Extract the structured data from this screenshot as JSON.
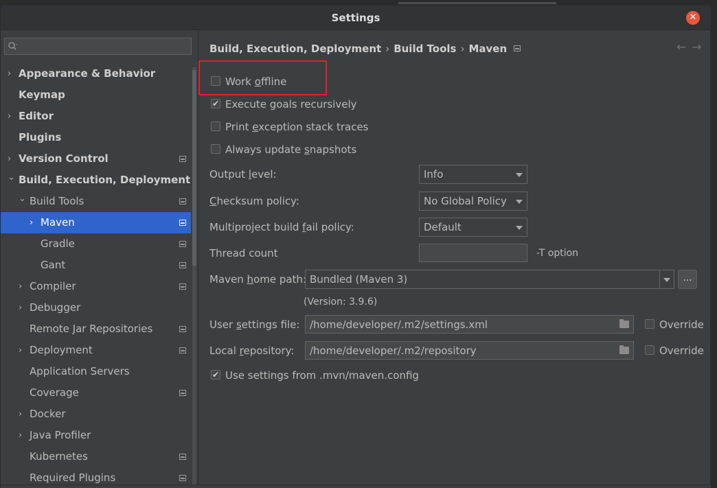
{
  "window": {
    "title": "Settings"
  },
  "search": {
    "placeholder": ""
  },
  "tree": [
    {
      "label": "Appearance & Behavior",
      "bold": true,
      "arrow": true,
      "level": 0
    },
    {
      "label": "Keymap",
      "bold": true,
      "arrow": false,
      "level": 0
    },
    {
      "label": "Editor",
      "bold": true,
      "arrow": true,
      "level": 0
    },
    {
      "label": "Plugins",
      "bold": true,
      "arrow": false,
      "level": 0
    },
    {
      "label": "Version Control",
      "bold": true,
      "arrow": true,
      "level": 0,
      "project": true
    },
    {
      "label": "Build, Execution, Deployment",
      "bold": true,
      "arrow": true,
      "expanded": true,
      "level": 0
    },
    {
      "label": "Build Tools",
      "bold": false,
      "arrow": true,
      "expanded": true,
      "level": 1,
      "project": true
    },
    {
      "label": "Maven",
      "bold": false,
      "arrow": true,
      "level": 2,
      "project": true,
      "selected": true
    },
    {
      "label": "Gradle",
      "bold": false,
      "arrow": false,
      "level": 2,
      "project": true
    },
    {
      "label": "Gant",
      "bold": false,
      "arrow": false,
      "level": 2,
      "project": true
    },
    {
      "label": "Compiler",
      "bold": false,
      "arrow": true,
      "level": 1,
      "project": true
    },
    {
      "label": "Debugger",
      "bold": false,
      "arrow": true,
      "level": 1
    },
    {
      "label": "Remote Jar Repositories",
      "bold": false,
      "arrow": false,
      "level": 1,
      "project": true
    },
    {
      "label": "Deployment",
      "bold": false,
      "arrow": true,
      "level": 1,
      "project": true
    },
    {
      "label": "Application Servers",
      "bold": false,
      "arrow": false,
      "level": 1
    },
    {
      "label": "Coverage",
      "bold": false,
      "arrow": false,
      "level": 1,
      "project": true
    },
    {
      "label": "Docker",
      "bold": false,
      "arrow": true,
      "level": 1
    },
    {
      "label": "Java Profiler",
      "bold": false,
      "arrow": true,
      "level": 1
    },
    {
      "label": "Kubernetes",
      "bold": false,
      "arrow": false,
      "level": 1,
      "project": true
    },
    {
      "label": "Required Plugins",
      "bold": false,
      "arrow": false,
      "level": 1,
      "project": true
    }
  ],
  "breadcrumb": {
    "part1": "Build, Execution, Deployment",
    "part2": "Build Tools",
    "part3": "Maven",
    "sep": "›"
  },
  "nav": {
    "back": "←",
    "forward": "→"
  },
  "checkboxes": {
    "work_offline": {
      "pre": "Work ",
      "mn": "o",
      "post": "ffline",
      "checked": false
    },
    "execute_recursive": {
      "pre": "Execute goals recursively",
      "mn": "",
      "post": "",
      "checked": true
    },
    "print_exception": {
      "pre": "Print ",
      "mn": "e",
      "post": "xception stack traces",
      "checked": false
    },
    "always_update": {
      "pre": "Always update ",
      "mn": "s",
      "post": "napshots",
      "checked": false
    },
    "use_settings": {
      "pre": "Use settings from .mvn/maven.config",
      "mn": "",
      "post": "",
      "checked": true
    }
  },
  "fields": {
    "output_level": {
      "pre": "Output ",
      "mn": "l",
      "post": "evel:",
      "value": "Info"
    },
    "checksum_policy": {
      "pre": "",
      "mn": "C",
      "post": "hecksum policy:",
      "value": "No Global Policy"
    },
    "multiproject": {
      "pre": "Multiproject build ",
      "mn": "f",
      "post": "ail policy:",
      "value": "Default"
    },
    "thread_count": {
      "label": "Thread count",
      "value": "",
      "hint": "-T option"
    },
    "maven_home": {
      "pre": "Maven ",
      "mn": "h",
      "post": "ome path:",
      "value": "Bundled (Maven 3)",
      "button": "...",
      "version": "(Version: 3.9.6)"
    },
    "user_settings": {
      "pre": "User ",
      "mn": "s",
      "post": "ettings file:",
      "value": "/home/developer/.m2/settings.xml",
      "override": "Override"
    },
    "local_repo": {
      "pre": "Local ",
      "mn": "r",
      "post": "epository:",
      "value": "/home/developer/.m2/repository",
      "override": "Override"
    }
  },
  "colors": {
    "accent": "#2f65ca",
    "highlight": "#e3242b",
    "close": "#e9573f"
  }
}
